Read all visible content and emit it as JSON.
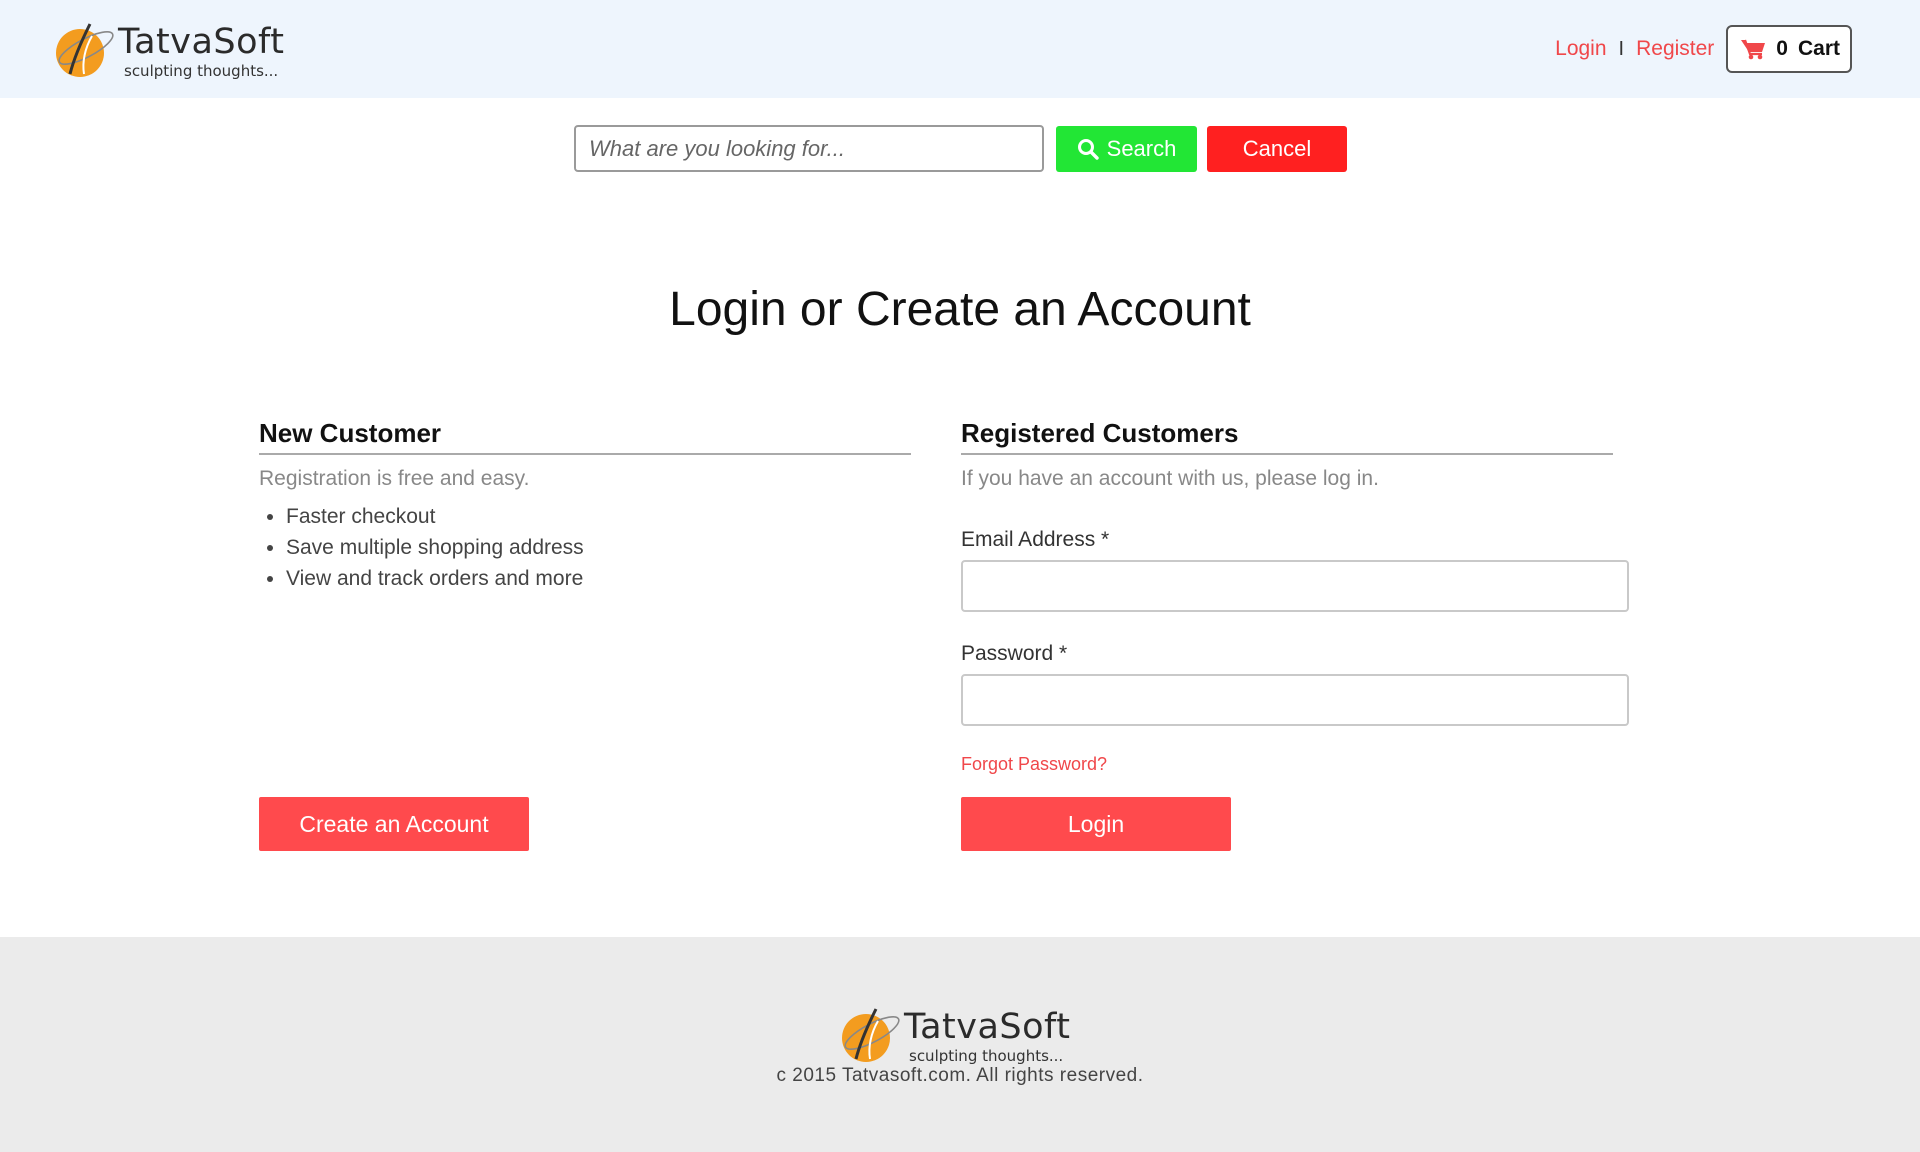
{
  "brand": {
    "name": "TatvaSoft",
    "tagline": "sculpting thoughts...",
    "accent": "#f0474a",
    "logo_orange": "#f39c1f"
  },
  "header": {
    "login_label": "Login",
    "separator": "I",
    "register_label": "Register",
    "cart_count": "0",
    "cart_label": "Cart"
  },
  "search": {
    "placeholder": "What are you looking for...",
    "search_label": "Search",
    "cancel_label": "Cancel"
  },
  "page": {
    "title": "Login or Create an Account"
  },
  "new_customer": {
    "heading": "New Customer",
    "intro": "Registration is free and easy.",
    "benefits": [
      "Faster checkout",
      "Save multiple shopping address",
      "View and track orders and more"
    ],
    "create_button": "Create an Account"
  },
  "registered": {
    "heading": "Registered Customers",
    "intro": "If you have an account with us, please log in.",
    "email_label": "Email Address *",
    "password_label": "Password *",
    "forgot_label": "Forgot Password?",
    "login_button": "Login"
  },
  "footer": {
    "copyright": "c 2015 Tatvasoft.com. All rights reserved."
  }
}
